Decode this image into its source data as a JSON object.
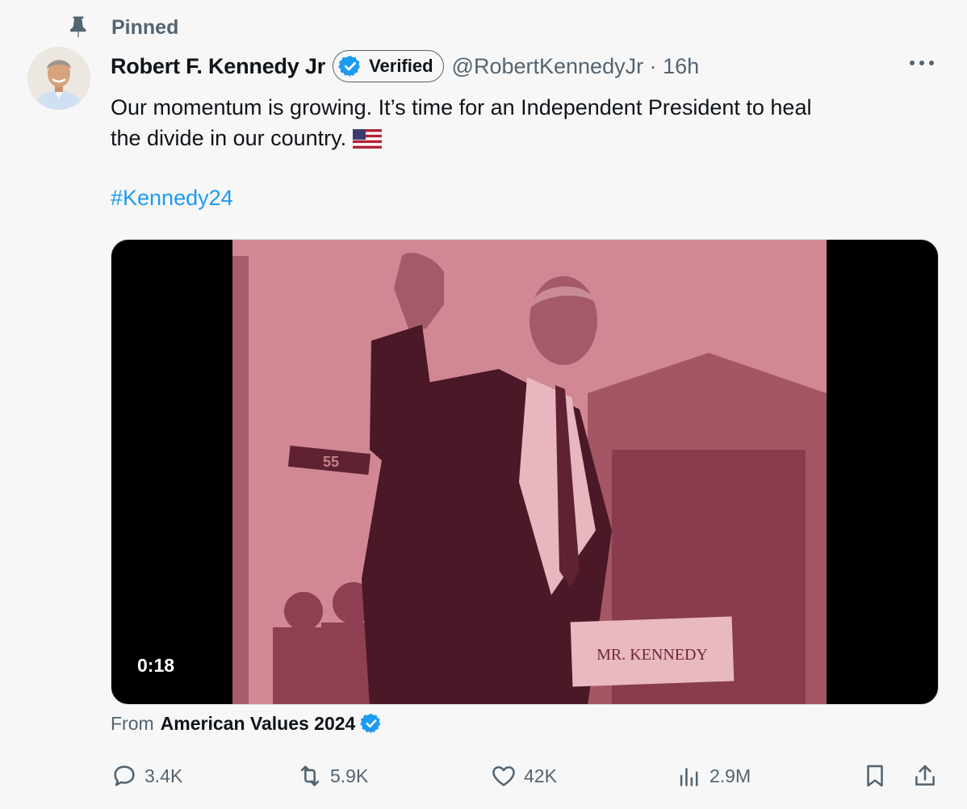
{
  "pinned_label": "Pinned",
  "author": {
    "name": "Robert F. Kennedy Jr",
    "verified_label": "Verified",
    "handle_time": "@RobertKennedyJr · 16h"
  },
  "tweet": {
    "line1": "Our momentum is growing. It’s time for an Independent President to heal",
    "line2": "the divide in our country.",
    "hashtag": "#Kennedy24"
  },
  "media": {
    "duration": "0:18",
    "nameplate": "MR. KENNEDY",
    "sign": "55"
  },
  "source": {
    "prefix": "From",
    "name": "American Values 2024"
  },
  "actions": {
    "replies": "3.4K",
    "reposts": "5.9K",
    "likes": "42K",
    "views": "2.9M"
  },
  "colors": {
    "accent": "#1d9bf0",
    "secondary_text": "#536471",
    "video_tint": "#c97d8a"
  }
}
